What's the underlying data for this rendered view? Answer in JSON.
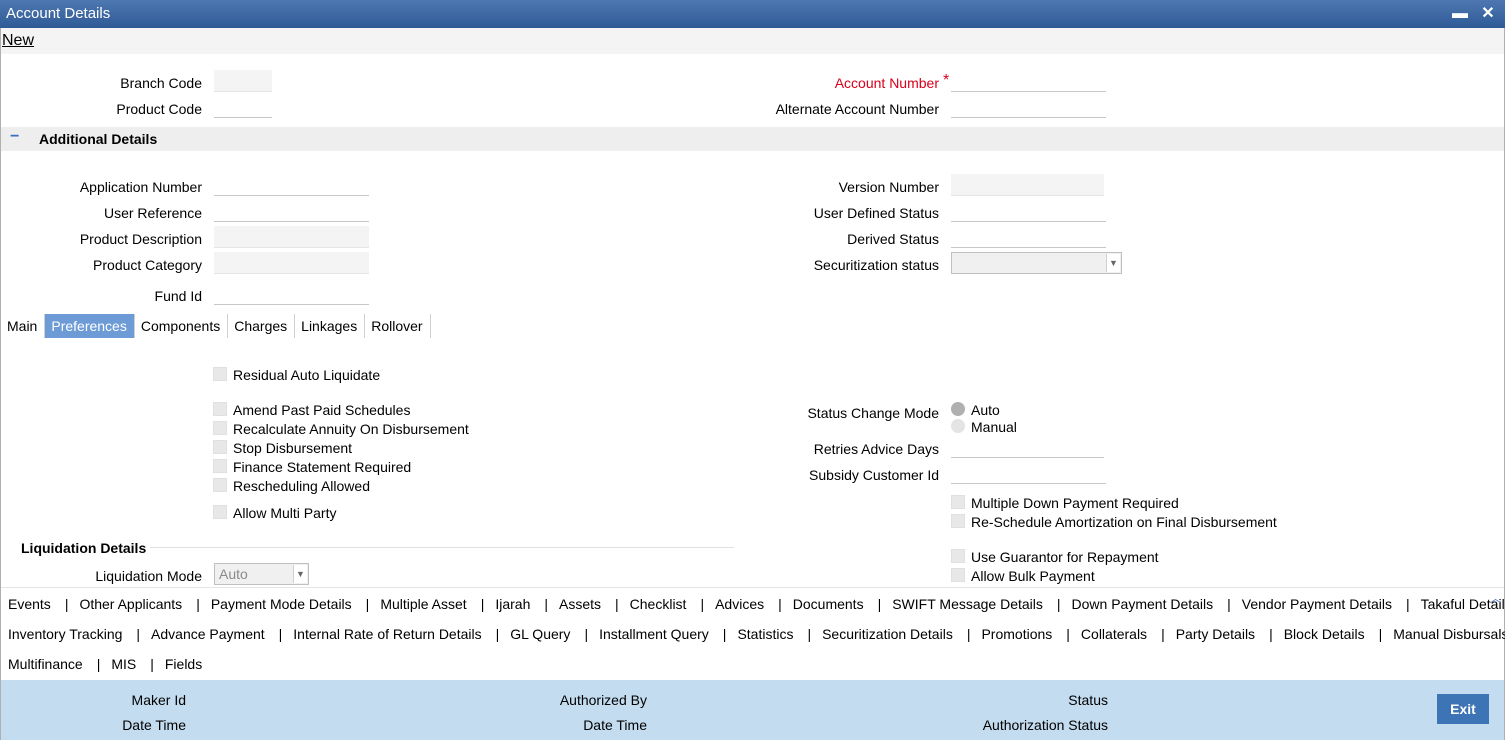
{
  "window": {
    "title": "Account Details",
    "minimize": "▬",
    "close": "✕"
  },
  "menu": {
    "new": "New"
  },
  "header": {
    "branch_code": "Branch Code",
    "product_code": "Product Code",
    "account_number": "Account Number",
    "required_mark": "*",
    "alternate_account_number": "Alternate Account Number"
  },
  "additional": {
    "toggle": "−",
    "title": "Additional Details",
    "application_number": "Application Number",
    "user_reference": "User Reference",
    "product_description": "Product Description",
    "product_category": "Product Category",
    "fund_id": "Fund Id",
    "version_number": "Version Number",
    "user_defined_status": "User Defined Status",
    "derived_status": "Derived Status",
    "securitization_status": "Securitization status",
    "securitization_value": ""
  },
  "tabs": [
    {
      "label": "Main"
    },
    {
      "label": "Preferences",
      "active": true
    },
    {
      "label": "Components"
    },
    {
      "label": "Charges"
    },
    {
      "label": "Linkages"
    },
    {
      "label": "Rollover"
    }
  ],
  "preferences": {
    "residual_auto_liquidate": "Residual Auto Liquidate",
    "amend_past_paid_schedules": "Amend Past Paid Schedules",
    "recalculate_annuity": "Recalculate Annuity On Disbursement",
    "stop_disbursement": "Stop Disbursement",
    "finance_statement_required": "Finance Statement Required",
    "rescheduling_allowed": "Rescheduling Allowed",
    "allow_multi_party": "Allow Multi Party",
    "status_change_mode": "Status Change Mode",
    "mode_auto": "Auto",
    "mode_manual": "Manual",
    "retries_advice_days": "Retries Advice Days",
    "subsidy_customer_id": "Subsidy Customer Id",
    "multiple_down_payment": "Multiple Down Payment Required",
    "reschedule_amortization": "Re-Schedule Amortization on Final Disbursement",
    "use_guarantor": "Use Guarantor for Repayment",
    "allow_bulk_payment": "Allow Bulk Payment",
    "liquidation_details": "Liquidation Details",
    "liquidation_mode": "Liquidation Mode",
    "liquidation_mode_value": "Auto"
  },
  "links": {
    "separator": "|",
    "row1": [
      "Events",
      "Other Applicants",
      "Payment Mode Details",
      "Multiple Asset",
      "Ijarah",
      "Assets",
      "Checklist",
      "Advices",
      "Documents",
      "SWIFT Message Details",
      "Down Payment Details",
      "Vendor Payment Details",
      "Takaful Details"
    ],
    "row2": [
      "Inventory Tracking",
      "Advance Payment",
      "Internal Rate of Return Details",
      "GL Query",
      "Installment Query",
      "Statistics",
      "Securitization Details",
      "Promotions",
      "Collaterals",
      "Party Details",
      "Block Details",
      "Manual Disbursals"
    ],
    "row3": [
      "Multifinance",
      "MIS",
      "Fields"
    ],
    "scroll_icon": "︿"
  },
  "footer": {
    "maker_id": "Maker Id",
    "date_time_1": "Date Time",
    "authorized_by": "Authorized By",
    "date_time_2": "Date Time",
    "status": "Status",
    "authorization_status": "Authorization Status",
    "exit": "Exit"
  }
}
